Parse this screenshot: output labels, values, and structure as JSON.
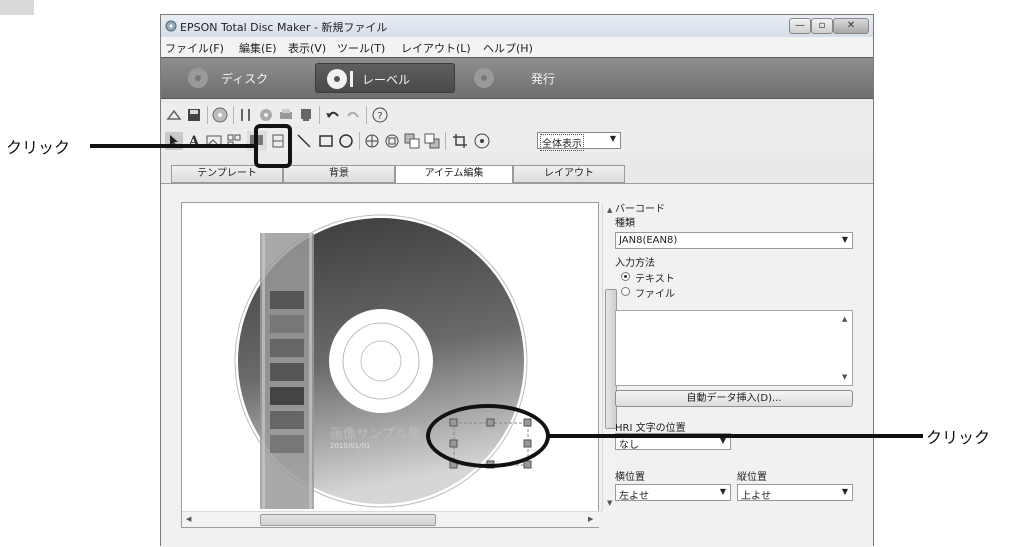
{
  "window": {
    "title": "EPSON Total Disc Maker - 新規ファイル",
    "controls": [
      "minimize",
      "maximize",
      "close"
    ]
  },
  "menu": [
    "ファイル(F)",
    "編集(E)",
    "表示(V)",
    "ツール(T)",
    "レイアウト(L)",
    "ヘルプ(H)"
  ],
  "modes": [
    {
      "label": "ディスク",
      "active": false
    },
    {
      "label": "レーベル",
      "active": true
    },
    {
      "label": "発行",
      "active": false
    }
  ],
  "toolbar": {
    "zoom_value": "全体表示",
    "row1_icons": [
      "new-icon",
      "save-icon",
      "disc-icon",
      "tools-icon",
      "print-preview-icon",
      "print-icon",
      "stamp-icon",
      "undo-icon",
      "redo-icon",
      "help-icon"
    ],
    "row2_icons": [
      "select-tool-icon",
      "text-tool-icon",
      "image-tool-icon",
      "qr-tool-icon",
      "barcode-tool-icon",
      "table-tool-icon",
      "line-tool-icon",
      "rect-tool-icon",
      "ellipse-tool-icon",
      "align-icon",
      "distribute-icon",
      "bring-front-icon",
      "send-back-icon",
      "crop-icon",
      "disc-guide-icon"
    ]
  },
  "tabs": [
    {
      "label": "テンプレート",
      "active": false
    },
    {
      "label": "背景",
      "active": false
    },
    {
      "label": "アイテム編集",
      "active": true
    },
    {
      "label": "レイアウト",
      "active": false
    }
  ],
  "canvas": {
    "disc_title": "画像サンプル集",
    "disc_date": "2010/01/01"
  },
  "panel": {
    "section": "バーコード",
    "type_label": "種類",
    "type_value": "JAN8(EAN8)",
    "input_label": "入力方法",
    "radio_text": "テキスト",
    "radio_file": "ファイル",
    "auto_insert_button": "自動データ挿入(D)...",
    "hri_label": "HRI 文字の位置",
    "hri_value": "なし",
    "horiz_label": "横位置",
    "horiz_value": "左よせ",
    "vert_label": "縦位置",
    "vert_value": "上よせ"
  },
  "callouts": {
    "left": "クリック",
    "right": "クリック"
  }
}
